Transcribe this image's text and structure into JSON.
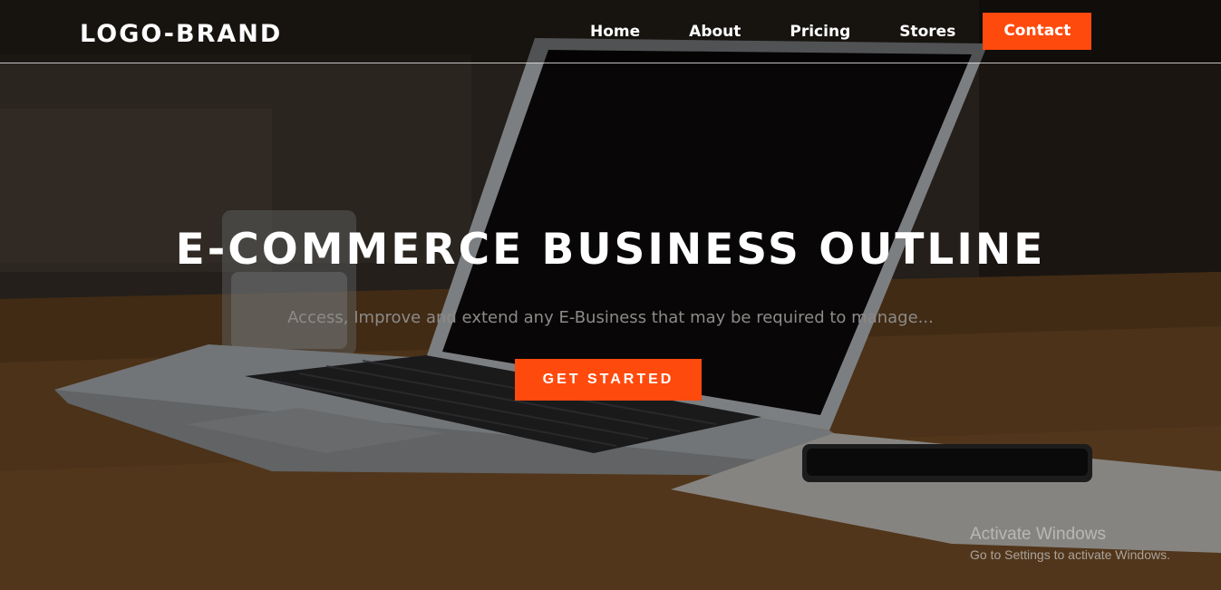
{
  "header": {
    "brand": "LOGO-BRAND",
    "nav": [
      {
        "label": "Home"
      },
      {
        "label": "About"
      },
      {
        "label": "Pricing"
      },
      {
        "label": "Stores"
      }
    ],
    "contact_label": "Contact"
  },
  "hero": {
    "title": "E-COMMERCE BUSINESS OUTLINE",
    "subtitle": "Access, Improve and extend any E-Business that may be required to manage...",
    "cta_label": "GET STARTED",
    "background_image": "laptop-on-desk-photo"
  },
  "watermark": {
    "title": "Activate Windows",
    "subtitle": "Go to Settings to activate Windows."
  },
  "colors": {
    "accent": "#ff4a0d",
    "text": "#ffffff",
    "subtitle": "#8d8a88"
  }
}
